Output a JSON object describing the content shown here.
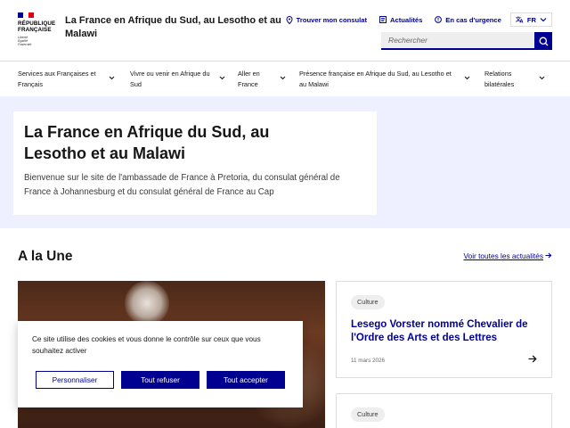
{
  "header": {
    "logo": {
      "line1": "RÉPUBLIQUE",
      "line2": "FRANÇAISE",
      "motto1": "Liberté",
      "motto2": "Égalité",
      "motto3": "Fraternité",
      "colors": [
        "#000091",
        "#ffffff",
        "#e1000f"
      ]
    },
    "site_title": "La France en Afrique du Sud, au Lesotho et au Malawi",
    "tools": {
      "consulate": "Trouver mon consulat",
      "news": "Actualités",
      "emergency": "En cas d'urgence",
      "lang": "FR"
    },
    "search": {
      "placeholder": "Rechercher"
    }
  },
  "nav": {
    "items": [
      {
        "label": "Services aux Françaises et Français"
      },
      {
        "label": "Vivre ou venir en Afrique du Sud"
      },
      {
        "label": "Aller en France"
      },
      {
        "label": "Présence française en Afrique du Sud, au Lesotho et au Malawi"
      },
      {
        "label": "Relations bilatérales"
      }
    ]
  },
  "hero": {
    "title": "La France en Afrique du Sud, au Lesotho et au Malawi",
    "description": "Bienvenue sur le site de l'ambassade de France à Pretoria, du consulat général de France à Johannesburg et du consulat général de France au Cap"
  },
  "une": {
    "title": "A la Une",
    "see_all": "Voir toutes les actualités",
    "cards": [
      {
        "tag": "Culture",
        "title": "Lesego Vorster nommé Chevalier de l'Ordre des Arts et des Lettres",
        "date": "11 mars 2026"
      },
      {
        "tag": "Culture"
      }
    ]
  },
  "cookie": {
    "text": "Ce site utilise des cookies et vous donne le contrôle sur ceux que vous souhaitez activer",
    "customize": "Personnaliser",
    "refuse": "Tout refuser",
    "accept": "Tout accepter"
  },
  "colors": {
    "primary": "#000091",
    "hero_bg": "#eef0ff",
    "marianne_red": "#e1000f"
  }
}
